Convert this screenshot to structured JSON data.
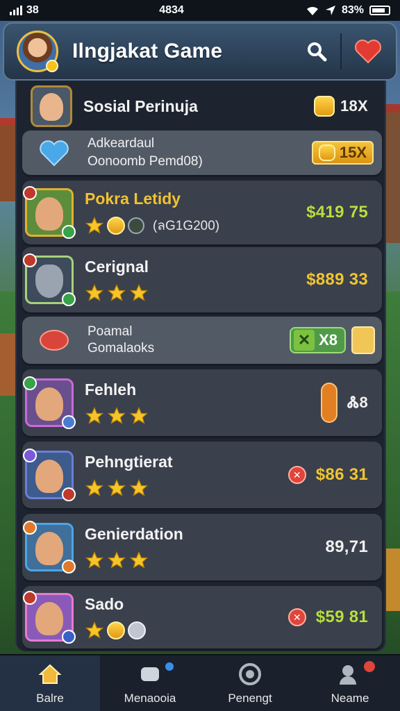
{
  "status_bar": {
    "left_text": "38",
    "time": "4834",
    "battery_text": "83%"
  },
  "header": {
    "title": "Ilngjakat Game"
  },
  "list": {
    "section_title": {
      "name": "Sosial Perinuja",
      "coin_value": "18X"
    },
    "promo_1": {
      "line1": "Adkeardaul",
      "line2": "Oonoomb Pemd08)",
      "badge_value": "15X"
    },
    "items": [
      {
        "name": "Pokra Letidy",
        "stars": 1,
        "extra": "(ลG1G200)",
        "price": "$419 75",
        "price_style": "green"
      },
      {
        "name": "Cerignal",
        "stars": 3,
        "price": "$889 33",
        "price_style": "yellow"
      },
      {
        "name": "Fehleh",
        "stars": 3,
        "price": "Ꮬ8",
        "price_style": "white"
      },
      {
        "name": "Pehngtierat",
        "stars": 3,
        "price": "$86 31",
        "price_style": "yellow"
      },
      {
        "name": "Genierdation",
        "stars": 3,
        "price": "89,71",
        "price_style": "white"
      },
      {
        "name": "Sado",
        "stars": 1,
        "price": "$59 81",
        "price_style": "green"
      }
    ],
    "promo_2": {
      "line1": "Poamal",
      "line2": "Gomalaoks",
      "badge_value": "X8"
    }
  },
  "nav": {
    "items": [
      {
        "label": "Balre"
      },
      {
        "label": "Menaooia"
      },
      {
        "label": "Penengt"
      },
      {
        "label": "Neame"
      }
    ]
  },
  "colors": {
    "accent_gold": "#f2c230",
    "price_green": "#b7df3c",
    "alert_red": "#e0443a"
  }
}
